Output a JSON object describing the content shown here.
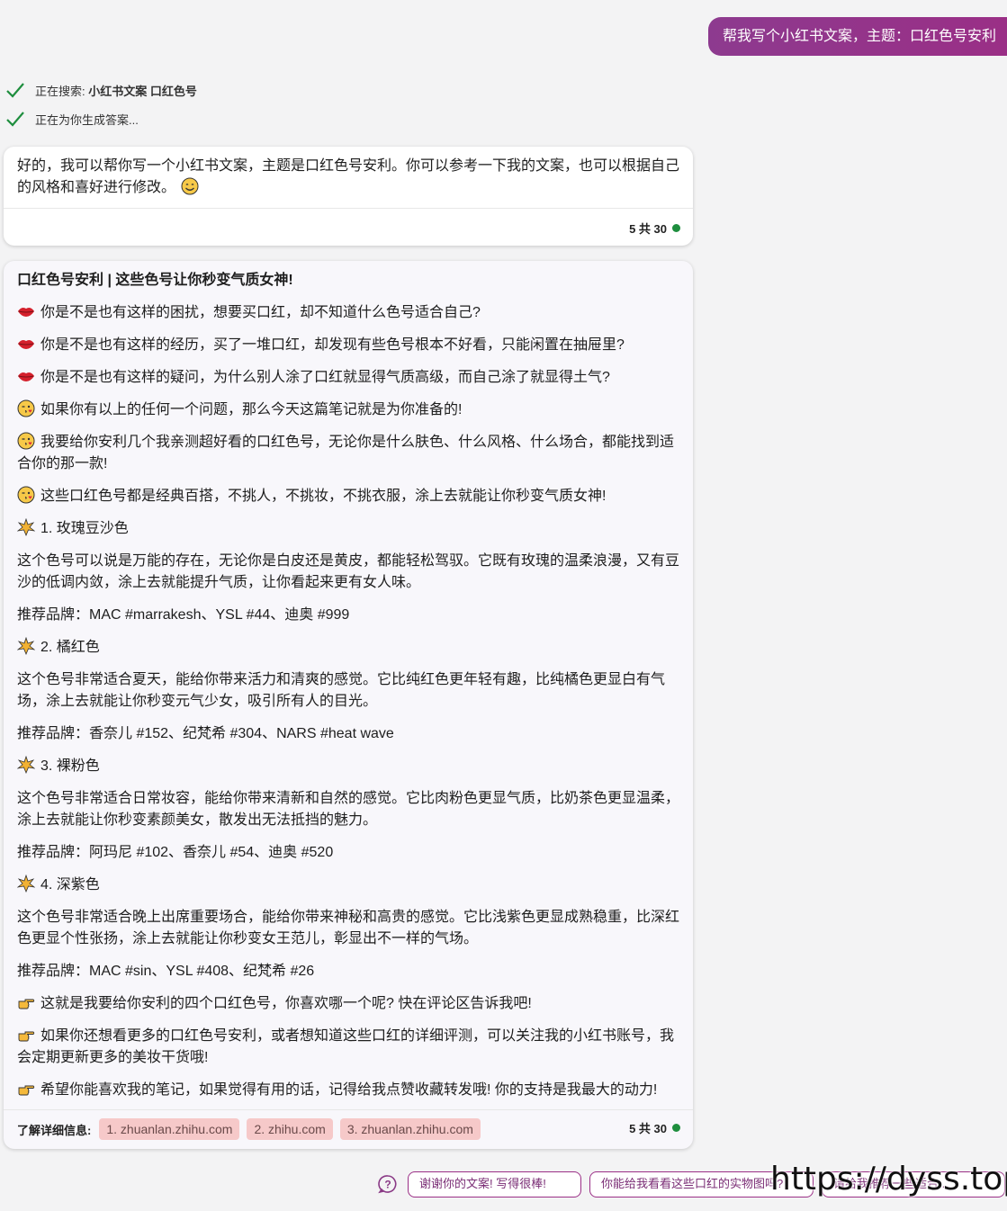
{
  "user_message": "帮我写个小红书文案，主题：口红色号安利",
  "status": {
    "searching_prefix": "正在搜索:",
    "searching_query": "小红书文案 口红色号",
    "generating": "正在为你生成答案..."
  },
  "intro": {
    "text": "好的，我可以帮你写一个小红书文案，主题是口红色号安利。你可以参考一下我的文案，也可以根据自己的风格和喜好进行修改。",
    "counter": "5 共 30"
  },
  "answer": {
    "title": "口红色号安利 | 这些色号让你秒变气质女神!",
    "paragraphs": [
      {
        "icon": "lips-icon",
        "text": "你是不是也有这样的困扰，想要买口红，却不知道什么色号适合自己?"
      },
      {
        "icon": "lips-icon",
        "text": "你是不是也有这样的经历，买了一堆口红，却发现有些色号根本不好看，只能闲置在抽屉里?"
      },
      {
        "icon": "lips-icon",
        "text": "你是不是也有这样的疑问，为什么别人涂了口红就显得气质高级，而自己涂了就显得土气?"
      },
      {
        "icon": "wink-kiss-icon",
        "text": "如果你有以上的任何一个问题，那么今天这篇笔记就是为你准备的!"
      },
      {
        "icon": "wink-kiss-icon",
        "text": "我要给你安利几个我亲测超好看的口红色号，无论你是什么肤色、什么风格、什么场合，都能找到适合你的那一款!"
      },
      {
        "icon": "wink-kiss-icon",
        "text": "这些口红色号都是经典百搭，不挑人，不挑妆，不挑衣服，涂上去就能让你秒变气质女神!"
      },
      {
        "icon": "sparkle-icon",
        "text": "1. 玫瑰豆沙色"
      },
      {
        "icon": "",
        "text": "这个色号可以说是万能的存在，无论你是白皮还是黄皮，都能轻松驾驭。它既有玫瑰的温柔浪漫，又有豆沙的低调内敛，涂上去就能提升气质，让你看起来更有女人味。"
      },
      {
        "icon": "",
        "text": "推荐品牌：MAC #marrakesh、YSL #44、迪奥 #999"
      },
      {
        "icon": "sparkle-icon",
        "text": "2. 橘红色"
      },
      {
        "icon": "",
        "text": "这个色号非常适合夏天，能给你带来活力和清爽的感觉。它比纯红色更年轻有趣，比纯橘色更显白有气场，涂上去就能让你秒变元气少女，吸引所有人的目光。"
      },
      {
        "icon": "",
        "text": "推荐品牌：香奈儿 #152、纪梵希 #304、NARS #heat wave"
      },
      {
        "icon": "sparkle-icon",
        "text": "3. 裸粉色"
      },
      {
        "icon": "",
        "text": "这个色号非常适合日常妆容，能给你带来清新和自然的感觉。它比肉粉色更显气质，比奶茶色更显温柔，涂上去就能让你秒变素颜美女，散发出无法抵挡的魅力。"
      },
      {
        "icon": "",
        "text": "推荐品牌：阿玛尼 #102、香奈儿 #54、迪奥 #520"
      },
      {
        "icon": "sparkle-icon",
        "text": "4. 深紫色"
      },
      {
        "icon": "",
        "text": "这个色号非常适合晚上出席重要场合，能给你带来神秘和高贵的感觉。它比浅紫色更显成熟稳重，比深红色更显个性张扬，涂上去就能让你秒变女王范儿，彰显出不一样的气场。"
      },
      {
        "icon": "",
        "text": "推荐品牌：MAC #sin、YSL #408、纪梵希 #26"
      },
      {
        "icon": "pointing-hand-icon",
        "text": "这就是我要给你安利的四个口红色号，你喜欢哪一个呢? 快在评论区告诉我吧!"
      },
      {
        "icon": "pointing-hand-icon",
        "text": "如果你还想看更多的口红色号安利，或者想知道这些口红的详细评测，可以关注我的小红书账号，我会定期更新更多的美妆干货哦!"
      },
      {
        "icon": "pointing-hand-icon",
        "text": "希望你能喜欢我的笔记，如果觉得有用的话，记得给我点赞收藏转发哦! 你的支持是我最大的动力!"
      }
    ],
    "refs_label": "了解详细信息:",
    "refs": [
      "1. zhuanlan.zhihu.com",
      "2. zhihu.com",
      "3. zhuanlan.zhihu.com"
    ],
    "counter": "5 共 30"
  },
  "suggestions": [
    "谢谢你的文案! 写得很棒!",
    "你能给我看看这些口红的实物图吗?",
    "请给我推荐一些适合..."
  ],
  "watermark": "https://dyss.top"
}
